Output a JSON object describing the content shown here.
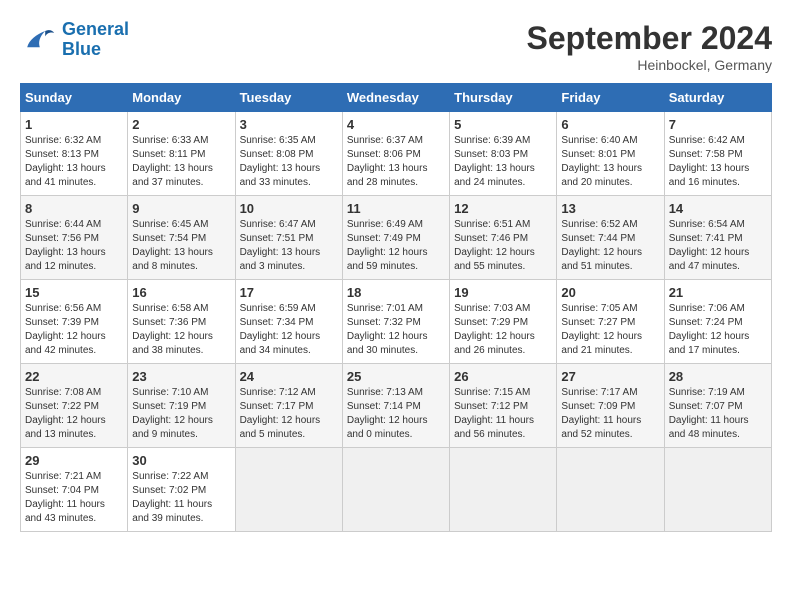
{
  "header": {
    "logo_line1": "General",
    "logo_line2": "Blue",
    "month": "September 2024",
    "location": "Heinbockel, Germany"
  },
  "days_of_week": [
    "Sunday",
    "Monday",
    "Tuesday",
    "Wednesday",
    "Thursday",
    "Friday",
    "Saturday"
  ],
  "weeks": [
    [
      {
        "day": "1",
        "info": "Sunrise: 6:32 AM\nSunset: 8:13 PM\nDaylight: 13 hours\nand 41 minutes."
      },
      {
        "day": "2",
        "info": "Sunrise: 6:33 AM\nSunset: 8:11 PM\nDaylight: 13 hours\nand 37 minutes."
      },
      {
        "day": "3",
        "info": "Sunrise: 6:35 AM\nSunset: 8:08 PM\nDaylight: 13 hours\nand 33 minutes."
      },
      {
        "day": "4",
        "info": "Sunrise: 6:37 AM\nSunset: 8:06 PM\nDaylight: 13 hours\nand 28 minutes."
      },
      {
        "day": "5",
        "info": "Sunrise: 6:39 AM\nSunset: 8:03 PM\nDaylight: 13 hours\nand 24 minutes."
      },
      {
        "day": "6",
        "info": "Sunrise: 6:40 AM\nSunset: 8:01 PM\nDaylight: 13 hours\nand 20 minutes."
      },
      {
        "day": "7",
        "info": "Sunrise: 6:42 AM\nSunset: 7:58 PM\nDaylight: 13 hours\nand 16 minutes."
      }
    ],
    [
      {
        "day": "8",
        "info": "Sunrise: 6:44 AM\nSunset: 7:56 PM\nDaylight: 13 hours\nand 12 minutes."
      },
      {
        "day": "9",
        "info": "Sunrise: 6:45 AM\nSunset: 7:54 PM\nDaylight: 13 hours\nand 8 minutes."
      },
      {
        "day": "10",
        "info": "Sunrise: 6:47 AM\nSunset: 7:51 PM\nDaylight: 13 hours\nand 3 minutes."
      },
      {
        "day": "11",
        "info": "Sunrise: 6:49 AM\nSunset: 7:49 PM\nDaylight: 12 hours\nand 59 minutes."
      },
      {
        "day": "12",
        "info": "Sunrise: 6:51 AM\nSunset: 7:46 PM\nDaylight: 12 hours\nand 55 minutes."
      },
      {
        "day": "13",
        "info": "Sunrise: 6:52 AM\nSunset: 7:44 PM\nDaylight: 12 hours\nand 51 minutes."
      },
      {
        "day": "14",
        "info": "Sunrise: 6:54 AM\nSunset: 7:41 PM\nDaylight: 12 hours\nand 47 minutes."
      }
    ],
    [
      {
        "day": "15",
        "info": "Sunrise: 6:56 AM\nSunset: 7:39 PM\nDaylight: 12 hours\nand 42 minutes."
      },
      {
        "day": "16",
        "info": "Sunrise: 6:58 AM\nSunset: 7:36 PM\nDaylight: 12 hours\nand 38 minutes."
      },
      {
        "day": "17",
        "info": "Sunrise: 6:59 AM\nSunset: 7:34 PM\nDaylight: 12 hours\nand 34 minutes."
      },
      {
        "day": "18",
        "info": "Sunrise: 7:01 AM\nSunset: 7:32 PM\nDaylight: 12 hours\nand 30 minutes."
      },
      {
        "day": "19",
        "info": "Sunrise: 7:03 AM\nSunset: 7:29 PM\nDaylight: 12 hours\nand 26 minutes."
      },
      {
        "day": "20",
        "info": "Sunrise: 7:05 AM\nSunset: 7:27 PM\nDaylight: 12 hours\nand 21 minutes."
      },
      {
        "day": "21",
        "info": "Sunrise: 7:06 AM\nSunset: 7:24 PM\nDaylight: 12 hours\nand 17 minutes."
      }
    ],
    [
      {
        "day": "22",
        "info": "Sunrise: 7:08 AM\nSunset: 7:22 PM\nDaylight: 12 hours\nand 13 minutes."
      },
      {
        "day": "23",
        "info": "Sunrise: 7:10 AM\nSunset: 7:19 PM\nDaylight: 12 hours\nand 9 minutes."
      },
      {
        "day": "24",
        "info": "Sunrise: 7:12 AM\nSunset: 7:17 PM\nDaylight: 12 hours\nand 5 minutes."
      },
      {
        "day": "25",
        "info": "Sunrise: 7:13 AM\nSunset: 7:14 PM\nDaylight: 12 hours\nand 0 minutes."
      },
      {
        "day": "26",
        "info": "Sunrise: 7:15 AM\nSunset: 7:12 PM\nDaylight: 11 hours\nand 56 minutes."
      },
      {
        "day": "27",
        "info": "Sunrise: 7:17 AM\nSunset: 7:09 PM\nDaylight: 11 hours\nand 52 minutes."
      },
      {
        "day": "28",
        "info": "Sunrise: 7:19 AM\nSunset: 7:07 PM\nDaylight: 11 hours\nand 48 minutes."
      }
    ],
    [
      {
        "day": "29",
        "info": "Sunrise: 7:21 AM\nSunset: 7:04 PM\nDaylight: 11 hours\nand 43 minutes."
      },
      {
        "day": "30",
        "info": "Sunrise: 7:22 AM\nSunset: 7:02 PM\nDaylight: 11 hours\nand 39 minutes."
      },
      {
        "day": "",
        "info": ""
      },
      {
        "day": "",
        "info": ""
      },
      {
        "day": "",
        "info": ""
      },
      {
        "day": "",
        "info": ""
      },
      {
        "day": "",
        "info": ""
      }
    ]
  ]
}
